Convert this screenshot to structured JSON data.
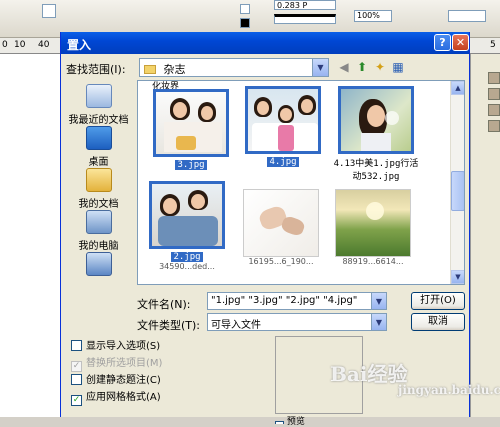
{
  "app": {
    "ruler_ticks": [
      "0",
      "10",
      "40",
      "5"
    ],
    "toolbar_zoom": "100%",
    "toolbar_stroke": "0.283 P"
  },
  "dialog": {
    "title": "置入",
    "help": "?",
    "close": "✕",
    "look_in_label": "查找范围(I):",
    "look_in_value": "杂志",
    "places": [
      {
        "label": "我最近的文档",
        "icon": "recent-documents-icon"
      },
      {
        "label": "桌面",
        "icon": "desktop-icon"
      },
      {
        "label": "我的文档",
        "icon": "my-documents-icon"
      },
      {
        "label": "我的电脑",
        "icon": "my-computer-icon"
      },
      {
        "label": "",
        "icon": "network-places-icon"
      }
    ],
    "top_cut_label": "化妆界",
    "files": [
      {
        "name": "3.jpg",
        "selected": true
      },
      {
        "name": "4.jpg",
        "selected": true
      },
      {
        "name": "4.13中美1.jpg行活动532.jpg",
        "selected": true
      },
      {
        "name": "2.jpg",
        "selected": true
      },
      {
        "name": "",
        "selected": false
      },
      {
        "name": "",
        "selected": false
      }
    ],
    "partial_labels": [
      "34590...ded...",
      "16195...6_190...",
      "88919...6614..."
    ],
    "filename_label": "文件名(N):",
    "filename_value": "\"1.jpg\" \"3.jpg\" \"2.jpg\" \"4.jpg\"",
    "filetype_label": "文件类型(T):",
    "filetype_value": "可导入文件",
    "open_button": "打开(O)",
    "cancel_button": "取消",
    "options": [
      {
        "label": "显示导入选项(S)",
        "checked": false,
        "disabled": false
      },
      {
        "label": "替换所选项目(M)",
        "checked": true,
        "disabled": true
      },
      {
        "label": "创建静态题注(C)",
        "checked": false,
        "disabled": false
      },
      {
        "label": "应用网格格式(A)",
        "checked": true,
        "disabled": false
      }
    ],
    "preview_label": "预览"
  },
  "watermark": {
    "text": "Bai经验",
    "sub": "jingyan.baidu.com"
  }
}
